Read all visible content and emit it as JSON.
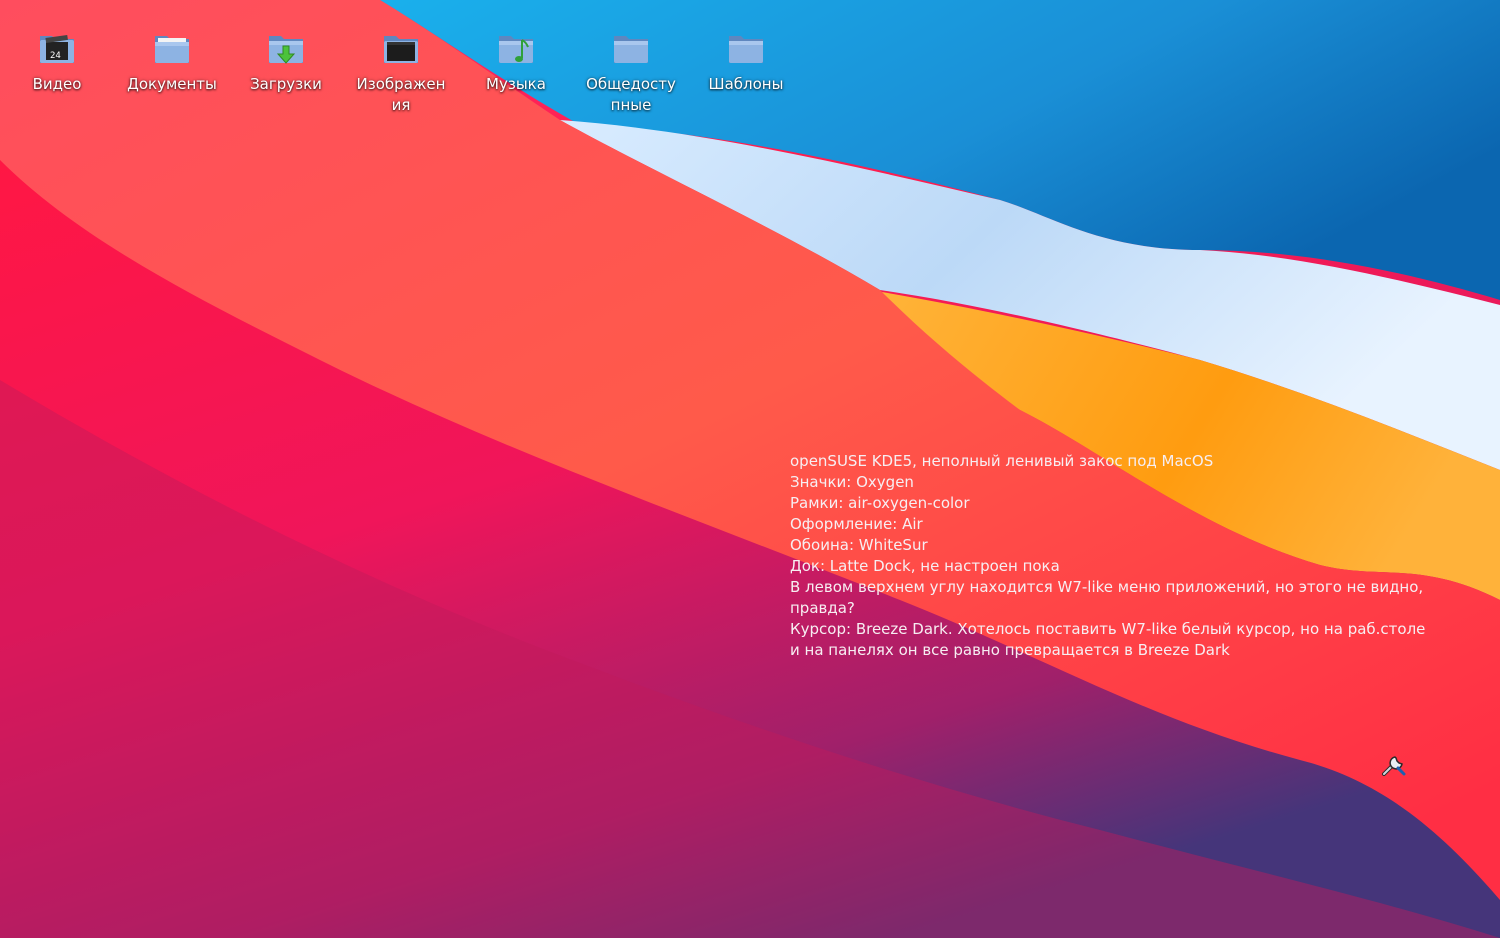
{
  "desktop": {
    "icons": [
      {
        "label": "Видео",
        "icon": "video-folder-icon"
      },
      {
        "label": "Документы",
        "icon": "documents-folder-icon"
      },
      {
        "label": "Загрузки",
        "icon": "downloads-folder-icon"
      },
      {
        "label": "Изображения",
        "icon": "pictures-folder-icon"
      },
      {
        "label": "Музыка",
        "icon": "music-folder-icon"
      },
      {
        "label": "Общедоступные",
        "icon": "public-folder-icon"
      },
      {
        "label": "Шаблоны",
        "icon": "templates-folder-icon"
      }
    ],
    "note_lines": [
      "openSUSE KDE5, неполный ленивый закос под MacOS",
      "Значки: Oxygen",
      "Рамки: air-oxygen-color",
      "Оформление: Air",
      "Обоина: WhiteSur",
      "Док: Latte Dock, не настроен пока",
      "В левом верхнем углу находится W7-like меню приложений, но этого не видно, правда?",
      "Курсор: Breeze Dark. Хотелось поставить W7-like белый курсор, но на раб.столе и на панелях он все равно превращается в Breeze Dark"
    ],
    "tool_icon": "wrench-screwdriver-icon"
  },
  "colors": {
    "label_text": "#ffffff",
    "note_text": "#f7eef2",
    "folder_blue": "#7fa6d8"
  }
}
